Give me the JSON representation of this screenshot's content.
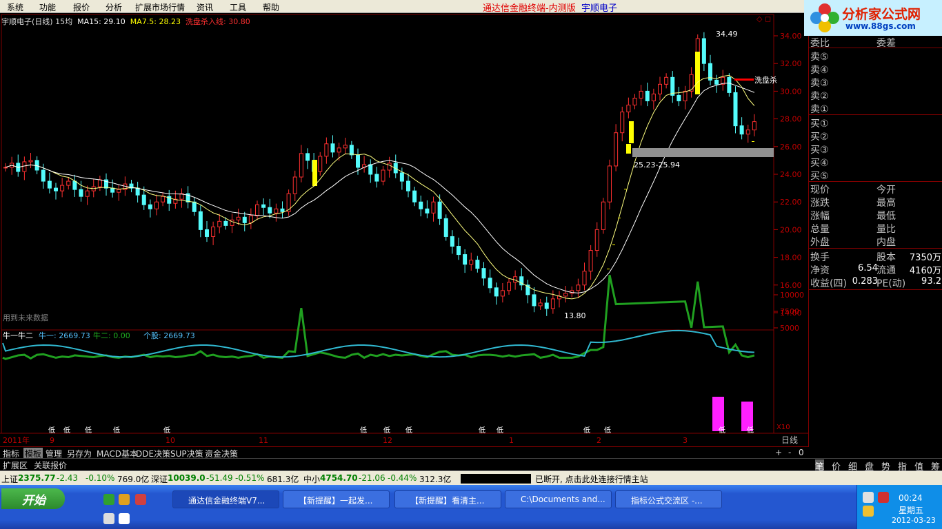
{
  "menu": [
    "系统",
    "功能",
    "报价",
    "分析",
    "扩展市场行情",
    "资讯",
    "工具",
    "帮助"
  ],
  "app_title": "通达信金融终端-内测版",
  "stock_name": "宇顺电子",
  "logo": {
    "text": "分析家公式网",
    "url": "www.88gs.com"
  },
  "info": {
    "title": "宇顺电子(日线) 15均",
    "ma15": "MA15: 29.10",
    "ma75": "MA7.5: 28.23",
    "wash": "洗盘杀入线: 30.80"
  },
  "chart_data": {
    "type": "candlestick",
    "y_ticks": [
      "34.00",
      "32.00",
      "30.00",
      "28.00",
      "26.00",
      "24.00",
      "22.00",
      "20.00",
      "18.00",
      "16.00",
      "14.00"
    ],
    "ylim": [
      13,
      35
    ],
    "high_label": "34.49",
    "low_label": "13.80",
    "zone_label": "25.23-25.94",
    "wash_label": "洗盘杀",
    "future_label": "用到未来数据",
    "x_labels": [
      "2011年",
      "9",
      "10",
      "11",
      "12",
      "1",
      "2",
      "3"
    ],
    "lower": {
      "title": "牛一牛二",
      "n1": "牛一: 2669.73",
      "n2": "牛二: 0.00",
      "stock": "个股: 2669.73",
      "y_ticks": [
        "10000",
        "7500",
        "5000"
      ],
      "scale": "X10",
      "low_marker": "低",
      "low_marker_alt": "诚低"
    },
    "closes": [
      24.5,
      24.8,
      24.2,
      24.9,
      25.0,
      24.3,
      23.5,
      23.0,
      22.8,
      23.2,
      23.5,
      22.9,
      22.4,
      22.8,
      23.1,
      23.6,
      23.0,
      22.7,
      22.9,
      23.3,
      23.0,
      22.5,
      21.8,
      21.5,
      22.0,
      22.4,
      21.9,
      22.2,
      22.6,
      22.0,
      21.3,
      20.0,
      19.5,
      20.2,
      20.6,
      20.3,
      20.7,
      20.9,
      20.5,
      21.0,
      21.8,
      21.6,
      21.2,
      21.5,
      21.3,
      22.6,
      23.8,
      25.5,
      25.0,
      24.2,
      25.3,
      26.2,
      25.6,
      25.9,
      26.1,
      25.4,
      24.5,
      24.7,
      24.0,
      23.5,
      24.3,
      24.8,
      24.1,
      23.5,
      22.8,
      22.0,
      21.5,
      21.2,
      22.0,
      20.8,
      19.5,
      18.8,
      18.2,
      17.5,
      17.8,
      17.2,
      16.5,
      15.8,
      15.2,
      15.6,
      16.2,
      16.6,
      16.0,
      15.3,
      14.5,
      14.7,
      14.3,
      15.0,
      15.2,
      15.4,
      15.6,
      16.0,
      17.0,
      18.5,
      20.0,
      22.0,
      24.6,
      27.0,
      28.5,
      29.0,
      29.5,
      30.0,
      29.3,
      29.8,
      30.5,
      31.0,
      29.7,
      29.3,
      30.0,
      31.2,
      33.8,
      32.0,
      30.8,
      30.5,
      31.0,
      29.9,
      27.5,
      26.9,
      27.2,
      27.8
    ]
  },
  "panel": {
    "wb": "委比",
    "wc": "委差",
    "sell": [
      "卖⑤",
      "卖④",
      "卖③",
      "卖②",
      "卖①"
    ],
    "buy": [
      "买①",
      "买②",
      "买③",
      "买④",
      "买⑤"
    ],
    "l1": [
      "现价",
      "涨跌",
      "涨幅",
      "总量",
      "外盘"
    ],
    "l2": [
      "今开",
      "最高",
      "最低",
      "量比",
      "内盘"
    ],
    "stats": [
      {
        "a": "换手",
        "b": "",
        "c": "股本",
        "d": "7350万"
      },
      {
        "a": "净资",
        "b": "6.54",
        "c": "流通",
        "d": "4160万"
      },
      {
        "a": "收益(四)",
        "b": "0.283",
        "c": "PE(动)",
        "d": "93.2"
      }
    ]
  },
  "tabs": [
    "指标",
    "模板",
    "管理",
    "另存为",
    "MACD基本",
    "DDE决策",
    "SUP决策",
    "资金决策"
  ],
  "tabs2": [
    "扩展区",
    "关联报价"
  ],
  "ptabs": [
    "笔",
    "价",
    "细",
    "盘",
    "势",
    "指",
    "值",
    "筹"
  ],
  "status": [
    {
      "name": "上证",
      "v": "2375.77",
      "c": "-2.43",
      "p": "-0.10%",
      "a": "769.0亿"
    },
    {
      "name": "深证",
      "v": "10039.0",
      "c": "-51.49",
      "p": "-0.51%",
      "a": "681.3亿"
    },
    {
      "name": "中小",
      "v": "4754.70",
      "c": "-21.06",
      "p": "-0.44%",
      "a": "312.3亿"
    }
  ],
  "disconnect": "已断开, 点击此处连接行情主站",
  "taskbar": {
    "start": "开始",
    "buttons": [
      "通达信金融终端V7...",
      "【新提醒】一起发...",
      "【新提醒】看清主...",
      "C:\\Documents and...",
      "指标公式交流区 -..."
    ],
    "time": "00:24",
    "day": "星期五",
    "date": "2012-03-23"
  }
}
